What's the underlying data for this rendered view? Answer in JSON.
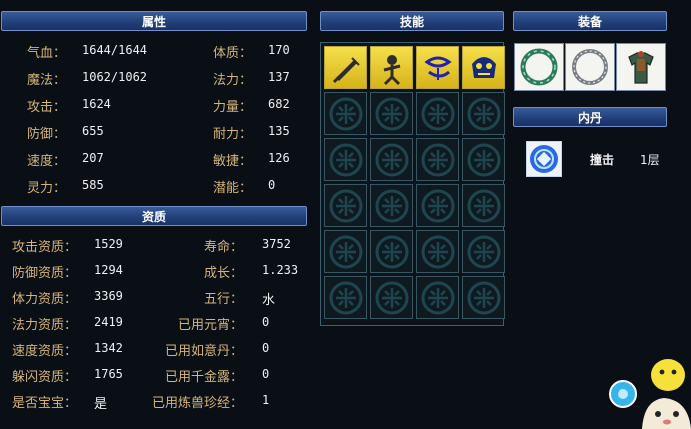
{
  "attributes": {
    "title": "属性",
    "left": [
      {
        "label": "气血：",
        "value": "1644/1644"
      },
      {
        "label": "魔法：",
        "value": "1062/1062"
      },
      {
        "label": "攻击：",
        "value": "1624"
      },
      {
        "label": "防御：",
        "value": "655"
      },
      {
        "label": "速度：",
        "value": "207"
      },
      {
        "label": "灵力：",
        "value": "585"
      }
    ],
    "right": [
      {
        "label": "体质：",
        "value": "170"
      },
      {
        "label": "法力：",
        "value": "137"
      },
      {
        "label": "力量：",
        "value": "682"
      },
      {
        "label": "耐力：",
        "value": "135"
      },
      {
        "label": "敏捷：",
        "value": "126"
      },
      {
        "label": "潜能：",
        "value": "0"
      }
    ]
  },
  "aptitude": {
    "title": "资质",
    "left": [
      {
        "label": "攻击资质：",
        "value": "1529"
      },
      {
        "label": "防御资质：",
        "value": "1294"
      },
      {
        "label": "体力资质：",
        "value": "3369"
      },
      {
        "label": "法力资质：",
        "value": "2419"
      },
      {
        "label": "速度资质：",
        "value": "1342"
      },
      {
        "label": "躲闪资质：",
        "value": "1765"
      },
      {
        "label": "是否宝宝：",
        "value": "是"
      }
    ],
    "right": [
      {
        "label": "寿命：",
        "value": "3752"
      },
      {
        "label": "成长：",
        "value": "1.233"
      },
      {
        "label": "五行：",
        "value": "水"
      },
      {
        "label": "已用元宵：",
        "value": "0"
      },
      {
        "label": "已用如意丹：",
        "value": "0"
      },
      {
        "label": "已用千金露：",
        "value": "0"
      },
      {
        "label": "已用炼兽珍经：",
        "value": "1"
      }
    ]
  },
  "skills": {
    "title": "技能",
    "icons": [
      "sword-skill-icon",
      "fighter-skill-icon",
      "chain-skill-icon",
      "demon-skill-icon"
    ]
  },
  "equipment": {
    "title": "装备",
    "items": [
      "jade-ring-icon",
      "silver-ring-icon",
      "armor-icon"
    ]
  },
  "inner_pill": {
    "title": "内丹",
    "name": "撞击",
    "level": "1层"
  },
  "colors": {
    "label": "#d4b47a",
    "header": "#22407a",
    "skill_lit": "#e8cc2a"
  }
}
